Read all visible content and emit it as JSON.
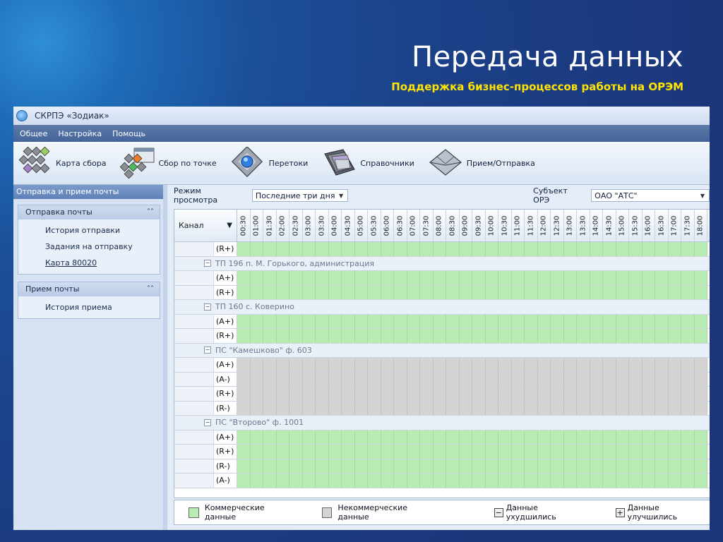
{
  "slide": {
    "title": "Передача данных",
    "subtitle": "Поддержка бизнес-процессов работы на ОРЭМ"
  },
  "window": {
    "title": "СКРПЭ «Зодиак»"
  },
  "menu": [
    "Общее",
    "Настройка",
    "Помощь"
  ],
  "toolbar": [
    {
      "label": "Карта сбора",
      "icon": "collect-map-icon"
    },
    {
      "label": "Сбор по точке",
      "icon": "point-collect-icon"
    },
    {
      "label": "Перетоки",
      "icon": "flows-icon"
    },
    {
      "label": "Справочники",
      "icon": "folders-icon"
    },
    {
      "label": "Прием/Отправка",
      "icon": "envelope-icon"
    }
  ],
  "sidebar": {
    "header": "Отправка и прием почты",
    "groups": [
      {
        "title": "Отправка почты",
        "items": [
          "История отправки",
          "Задания на отправку",
          "Карта 80020"
        ]
      },
      {
        "title": "Прием почты",
        "items": [
          "История приема"
        ]
      }
    ]
  },
  "filter": {
    "mode_label": "Режим просмотра",
    "mode_value": "Последние три дня",
    "subject_label": "Субъект ОРЭ",
    "subject_value": "ОАО \"АТС\""
  },
  "grid": {
    "channel_header": "Канал",
    "times": [
      "00:30",
      "01:00",
      "01:30",
      "02:00",
      "02:30",
      "03:00",
      "03:30",
      "04:00",
      "04:30",
      "05:00",
      "05:30",
      "06:00",
      "06:30",
      "07:00",
      "07:30",
      "08:00",
      "08:30",
      "09:00",
      "09:30",
      "10:00",
      "10:30",
      "11:00",
      "11:30",
      "12:00",
      "12:30",
      "13:00",
      "13:30",
      "14:00",
      "14:30",
      "15:00",
      "15:30",
      "16:00",
      "16:30",
      "17:00",
      "17:30",
      "18:00"
    ],
    "rows": [
      {
        "kind": "row",
        "label": "(R+)",
        "status": "commercial"
      },
      {
        "kind": "group",
        "label": "ТП 196 п. М. Горького, администрация"
      },
      {
        "kind": "row",
        "label": "(A+)",
        "status": "commercial"
      },
      {
        "kind": "row",
        "label": "(R+)",
        "status": "commercial"
      },
      {
        "kind": "group",
        "label": "ТП 160 с. Коверино"
      },
      {
        "kind": "row",
        "label": "(A+)",
        "status": "commercial"
      },
      {
        "kind": "row",
        "label": "(R+)",
        "status": "commercial"
      },
      {
        "kind": "group",
        "label": "ПС \"Камешково\" ф. 603"
      },
      {
        "kind": "row",
        "label": "(A+)",
        "status": "noncommercial"
      },
      {
        "kind": "row",
        "label": "(A-)",
        "status": "noncommercial"
      },
      {
        "kind": "row",
        "label": "(R+)",
        "status": "noncommercial"
      },
      {
        "kind": "row",
        "label": "(R-)",
        "status": "noncommercial"
      },
      {
        "kind": "group",
        "label": "ПС \"Второво\" ф. 1001"
      },
      {
        "kind": "row",
        "label": "(A+)",
        "status": "commercial"
      },
      {
        "kind": "row",
        "label": "(R+)",
        "status": "commercial"
      },
      {
        "kind": "row",
        "label": "(R-)",
        "status": "commercial"
      },
      {
        "kind": "row",
        "label": "(A-)",
        "status": "commercial"
      }
    ]
  },
  "legend": [
    {
      "label": "Коммерческие данные",
      "swatch": "#b9ecb3"
    },
    {
      "label": "Некоммерческие данные",
      "swatch": "#d4d4d4"
    },
    {
      "label": "Данные ухудшились",
      "mark": "−"
    },
    {
      "label": "Данные улучшились",
      "mark": "+"
    }
  ]
}
